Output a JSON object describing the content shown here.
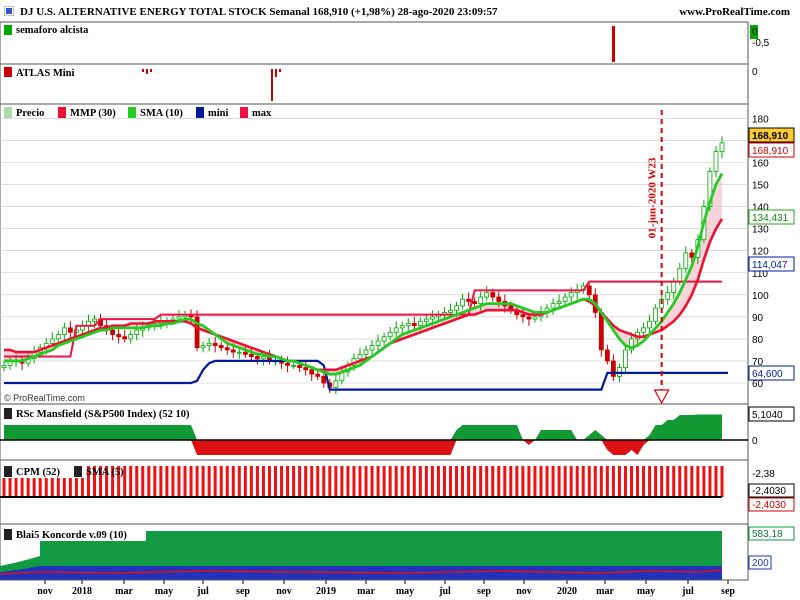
{
  "header": {
    "title": "DJ U.S. ALTERNATIVE ENERGY TOTAL STOCK Semanal 168,910 (+1,98%) 28-ago-2020 23:09:57",
    "site": "www.ProRealTime.com"
  },
  "colors": {
    "price_up": "#00aa00",
    "price_down": "#cc0000",
    "mmp": "#ee1133",
    "sma": "#22cc22",
    "mini": "#001a99",
    "max": "#ee1144",
    "grid": "#c8c8c8"
  },
  "panels": {
    "semaforo": {
      "label": "semaforo alcista",
      "ticks": [
        "0",
        "-0,5"
      ]
    },
    "atlas": {
      "label": "ATLAS Mini",
      "ticks": [
        "0"
      ]
    },
    "price": {
      "legend": [
        "Precio",
        "MMP (30)",
        "SMA (10)",
        "mini",
        "max"
      ],
      "ticks": [
        "180",
        "170",
        "160",
        "150",
        "140",
        "130",
        "120",
        "110",
        "100",
        "90",
        "80",
        "70",
        "60"
      ],
      "badges": [
        "168,910",
        "168,910",
        "134,431",
        "114,047",
        "64,600"
      ],
      "annotation": "01-jun-2020 W23",
      "watermark": "© ProRealTime.com"
    },
    "rsc": {
      "label": "RSc Mansfield (S&P500 Index) (52 10)",
      "ticks": [
        "0"
      ],
      "badge": "5,1040"
    },
    "cpm": {
      "legend": [
        "CPM (52)",
        "SMA (5)"
      ],
      "ticks": [
        "-2,38"
      ],
      "badges": [
        "-2,4030",
        "-2,4030"
      ]
    },
    "blai5": {
      "label": "Blai5 Koncorde v.09 (10)",
      "badges": [
        "583,18",
        "200"
      ]
    }
  },
  "x_axis": {
    "ticks": [
      "nov",
      "2018",
      "mar",
      "may",
      "jul",
      "sep",
      "nov",
      "2019",
      "mar",
      "may",
      "jul",
      "sep",
      "nov",
      "2020",
      "mar",
      "may",
      "jul",
      "sep"
    ]
  },
  "chart_data": {
    "type": "candlestick",
    "title": "DJ U.S. ALTERNATIVE ENERGY TOTAL STOCK Semanal",
    "x_unit": "weekly",
    "ylim": [
      57,
      185
    ],
    "price_close": [
      68,
      70,
      70,
      69,
      71,
      74,
      76,
      78,
      80,
      82,
      85,
      83,
      84,
      86,
      88,
      89,
      86,
      84,
      82,
      81,
      80,
      82,
      84,
      85,
      86,
      87,
      88,
      88,
      89,
      90,
      91,
      90,
      76,
      77,
      78,
      77,
      76,
      75,
      74,
      74,
      73,
      72,
      71,
      72,
      70,
      70,
      69,
      68,
      68,
      67,
      66,
      64,
      63,
      60,
      58,
      61,
      65,
      68,
      71,
      73,
      75,
      77,
      79,
      81,
      83,
      85,
      86,
      87,
      86,
      88,
      89,
      90,
      91,
      92,
      93,
      95,
      98,
      97,
      96,
      99,
      101,
      99,
      97,
      95,
      93,
      91,
      90,
      89,
      90,
      92,
      94,
      96,
      97,
      99,
      101,
      102,
      104,
      100,
      92,
      75,
      70,
      63,
      67,
      75,
      80,
      83,
      85,
      88,
      94,
      98,
      101,
      106,
      112,
      119,
      117,
      125,
      140,
      156,
      165,
      168.91
    ],
    "mmp30": [
      75,
      75,
      74,
      74,
      74,
      74,
      75,
      76,
      77,
      78,
      79,
      80,
      81,
      82,
      83,
      84,
      85,
      85,
      86,
      86,
      86,
      87,
      87,
      87,
      87,
      88,
      88,
      88,
      88,
      88,
      88,
      87,
      85,
      84,
      83,
      82,
      81,
      80,
      79,
      78,
      77,
      76,
      75,
      74,
      73,
      72,
      71,
      70,
      70,
      69,
      68,
      67,
      66,
      66,
      66,
      66,
      67,
      68,
      69,
      70,
      71,
      72,
      74,
      76,
      78,
      79,
      80,
      81,
      82,
      83,
      84,
      85,
      86,
      87,
      88,
      89,
      90,
      91,
      91,
      92,
      93,
      93,
      93,
      93,
      93,
      93,
      92,
      91,
      91,
      91,
      92,
      93,
      94,
      95,
      96,
      97,
      98,
      97,
      95,
      92,
      89,
      86,
      84,
      83,
      82,
      81,
      81,
      82,
      83,
      84,
      86,
      88,
      91,
      95,
      100,
      107,
      116,
      124,
      130,
      134.4
    ],
    "sma10": [
      70,
      70,
      70,
      70,
      71,
      72,
      73,
      74,
      75,
      77,
      78,
      79,
      80,
      81,
      82,
      83,
      84,
      84,
      85,
      85,
      85,
      85,
      85,
      85,
      86,
      86,
      86,
      87,
      87,
      88,
      89,
      89,
      87,
      86,
      84,
      82,
      80,
      78,
      77,
      76,
      75,
      74,
      73,
      73,
      72,
      72,
      71,
      70,
      70,
      69,
      68,
      67,
      66,
      65,
      64,
      64,
      65,
      66,
      67,
      68,
      70,
      72,
      74,
      76,
      78,
      80,
      82,
      83,
      84,
      85,
      86,
      87,
      88,
      89,
      90,
      91,
      92,
      93,
      94,
      95,
      96,
      96,
      96,
      96,
      96,
      95,
      94,
      93,
      92,
      92,
      92,
      93,
      94,
      95,
      96,
      97,
      98,
      98,
      96,
      92,
      88,
      84,
      80,
      77,
      76,
      77,
      79,
      82,
      85,
      88,
      92,
      96,
      101,
      107,
      113,
      122,
      133,
      142,
      150,
      155
    ],
    "mini": [
      60,
      60,
      60,
      60,
      60,
      60,
      60,
      60,
      60,
      60,
      60,
      60,
      60,
      60,
      60,
      60,
      60,
      60,
      60,
      60,
      60,
      60,
      60,
      60,
      60,
      60,
      60,
      60,
      60,
      60,
      60,
      60,
      61,
      66,
      69,
      70,
      70,
      70,
      70,
      70,
      70,
      70,
      70,
      70,
      70,
      70,
      70,
      70,
      70,
      70,
      70,
      70,
      70,
      68,
      57,
      57,
      57,
      57,
      57,
      57,
      57,
      57,
      57,
      57,
      57,
      57,
      57,
      57,
      57,
      57,
      57,
      57,
      57,
      57,
      57,
      57,
      57,
      57,
      57,
      57,
      57,
      57,
      57,
      57,
      57,
      57,
      57,
      57,
      57,
      57,
      57,
      57,
      57,
      57,
      57,
      57,
      57,
      57,
      57,
      57,
      64.6,
      64.6,
      64.6,
      64.6,
      64.6,
      64.6,
      64.6,
      64.6,
      64.6,
      64.6,
      64.6,
      64.6,
      64.6,
      64.6,
      64.6,
      64.6,
      64.6,
      64.6,
      64.6,
      64.6,
      64.6
    ],
    "max": [
      72,
      72,
      72,
      72,
      72,
      72,
      72,
      72,
      72,
      72,
      72,
      72,
      86,
      86,
      86,
      86,
      89,
      89,
      89,
      89,
      89,
      89,
      89,
      89,
      89,
      89,
      91,
      91,
      91,
      91,
      91,
      91,
      91,
      91,
      91,
      91,
      91,
      91,
      91,
      91,
      91,
      91,
      91,
      91,
      91,
      91,
      91,
      91,
      91,
      91,
      91,
      91,
      91,
      91,
      91,
      91,
      91,
      91,
      91,
      91,
      91,
      91,
      91,
      91,
      91,
      91,
      91,
      91,
      91,
      91,
      91,
      91,
      91,
      91,
      91,
      91,
      91,
      91,
      102,
      102,
      102,
      102,
      102,
      102,
      102,
      102,
      102,
      102,
      102,
      102,
      102,
      102,
      102,
      102,
      102,
      102,
      102,
      106,
      106,
      106,
      106,
      106,
      106,
      106,
      106,
      106,
      106,
      106,
      106,
      106,
      106,
      106,
      106,
      106,
      106,
      106,
      106,
      106,
      106,
      106
    ],
    "rsc_mansfield": [
      3,
      3,
      3,
      3,
      3,
      3,
      3,
      3,
      3,
      3,
      3,
      3,
      3,
      3,
      3,
      3,
      3,
      3,
      3,
      3,
      3,
      3,
      3,
      3,
      3,
      3,
      3,
      3,
      3,
      3,
      3,
      3,
      -3,
      -3,
      -3,
      -3,
      -3,
      -3,
      -3,
      -3,
      -3,
      -3,
      -3,
      -3,
      -3,
      -3,
      -3,
      -3,
      -3,
      -3,
      -3,
      -3,
      -3,
      -3,
      -3,
      -3,
      -3,
      -3,
      -3,
      -3,
      -3,
      -3,
      -3,
      -3,
      -3,
      -3,
      -3,
      -3,
      -3,
      -3,
      -3,
      -3,
      -3,
      -3,
      -3,
      2,
      3,
      3,
      3,
      3,
      3,
      3,
      3,
      3,
      3,
      3,
      0,
      -1,
      0,
      2,
      2,
      2,
      2,
      2,
      2,
      0,
      0,
      1,
      2,
      1,
      -2,
      -3,
      -3,
      -3,
      -2,
      -3,
      -1,
      1,
      3,
      3,
      4,
      4,
      5,
      5,
      5,
      5.1,
      5.1,
      5.1,
      5.1,
      5.1,
      5.1
    ],
    "cpm": -2.403,
    "cpm_sma": -2.403,
    "koncorde": 583.18,
    "koncorde_level": 200,
    "annotation_date": "01-jun-2020",
    "annotation_index": 109
  }
}
